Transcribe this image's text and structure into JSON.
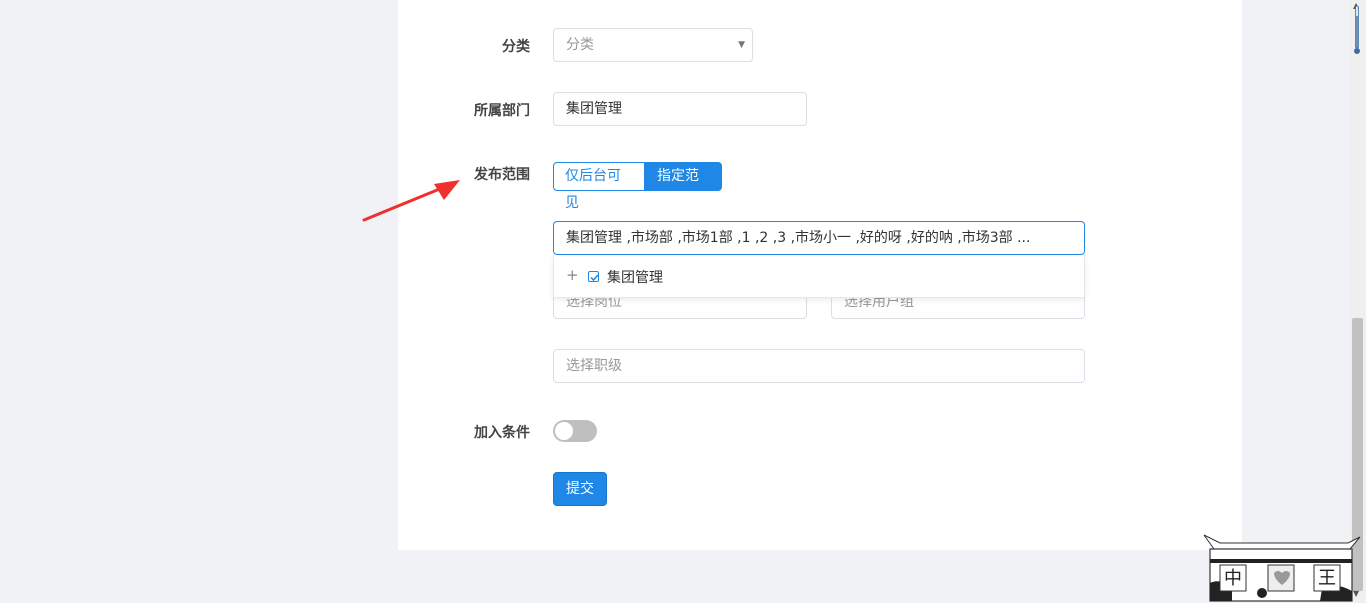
{
  "form": {
    "category": {
      "label": "分类",
      "placeholder": "分类"
    },
    "department": {
      "label": "所属部门",
      "value": "集团管理"
    },
    "scope": {
      "label": "发布范围",
      "options": [
        "仅后台可见",
        "指定范围"
      ],
      "selected": "指定范围",
      "summary_value": "集团管理 ,市场部 ,市场1部 ,1 ,2 ,3 ,市场小一 ,好的呀 ,好的呐 ,市场3部 ...",
      "tree_items": [
        {
          "label": "集团管理",
          "checked": true,
          "expandable": true
        }
      ],
      "position_placeholder": "选择岗位",
      "usergroup_placeholder": "选择用户组",
      "rank_placeholder": "选择职级"
    },
    "add_condition": {
      "label": "加入条件",
      "enabled": false
    },
    "submit_label": "提交"
  },
  "colors": {
    "accent": "#1f87e5",
    "annotation_arrow": "#f0302e",
    "page_background": "#f0f2f5"
  },
  "icons": {
    "select_arrow": "triangle-down",
    "tree_expand": "plus",
    "tree_checkbox": "checkbox-checked"
  }
}
